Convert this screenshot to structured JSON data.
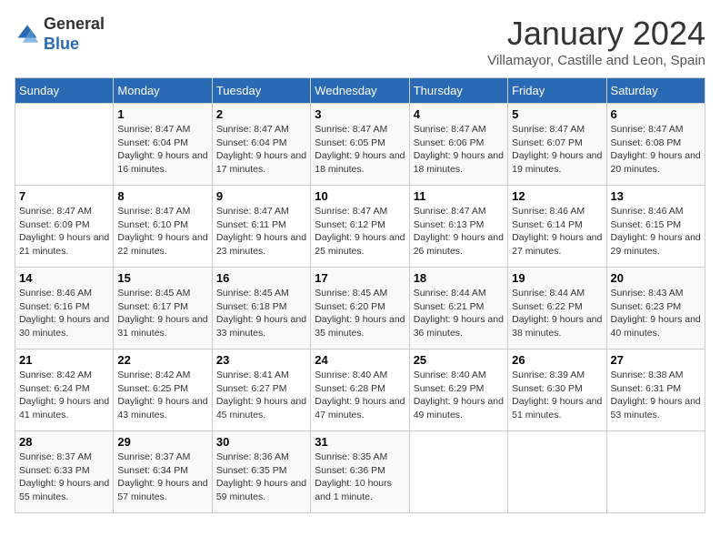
{
  "header": {
    "logo_line1": "General",
    "logo_line2": "Blue",
    "month": "January 2024",
    "location": "Villamayor, Castille and Leon, Spain"
  },
  "days_of_week": [
    "Sunday",
    "Monday",
    "Tuesday",
    "Wednesday",
    "Thursday",
    "Friday",
    "Saturday"
  ],
  "weeks": [
    [
      {
        "day": "",
        "sunrise": "",
        "sunset": "",
        "daylight": ""
      },
      {
        "day": "1",
        "sunrise": "Sunrise: 8:47 AM",
        "sunset": "Sunset: 6:04 PM",
        "daylight": "Daylight: 9 hours and 16 minutes."
      },
      {
        "day": "2",
        "sunrise": "Sunrise: 8:47 AM",
        "sunset": "Sunset: 6:04 PM",
        "daylight": "Daylight: 9 hours and 17 minutes."
      },
      {
        "day": "3",
        "sunrise": "Sunrise: 8:47 AM",
        "sunset": "Sunset: 6:05 PM",
        "daylight": "Daylight: 9 hours and 18 minutes."
      },
      {
        "day": "4",
        "sunrise": "Sunrise: 8:47 AM",
        "sunset": "Sunset: 6:06 PM",
        "daylight": "Daylight: 9 hours and 18 minutes."
      },
      {
        "day": "5",
        "sunrise": "Sunrise: 8:47 AM",
        "sunset": "Sunset: 6:07 PM",
        "daylight": "Daylight: 9 hours and 19 minutes."
      },
      {
        "day": "6",
        "sunrise": "Sunrise: 8:47 AM",
        "sunset": "Sunset: 6:08 PM",
        "daylight": "Daylight: 9 hours and 20 minutes."
      }
    ],
    [
      {
        "day": "7",
        "sunrise": "Sunrise: 8:47 AM",
        "sunset": "Sunset: 6:09 PM",
        "daylight": "Daylight: 9 hours and 21 minutes."
      },
      {
        "day": "8",
        "sunrise": "Sunrise: 8:47 AM",
        "sunset": "Sunset: 6:10 PM",
        "daylight": "Daylight: 9 hours and 22 minutes."
      },
      {
        "day": "9",
        "sunrise": "Sunrise: 8:47 AM",
        "sunset": "Sunset: 6:11 PM",
        "daylight": "Daylight: 9 hours and 23 minutes."
      },
      {
        "day": "10",
        "sunrise": "Sunrise: 8:47 AM",
        "sunset": "Sunset: 6:12 PM",
        "daylight": "Daylight: 9 hours and 25 minutes."
      },
      {
        "day": "11",
        "sunrise": "Sunrise: 8:47 AM",
        "sunset": "Sunset: 6:13 PM",
        "daylight": "Daylight: 9 hours and 26 minutes."
      },
      {
        "day": "12",
        "sunrise": "Sunrise: 8:46 AM",
        "sunset": "Sunset: 6:14 PM",
        "daylight": "Daylight: 9 hours and 27 minutes."
      },
      {
        "day": "13",
        "sunrise": "Sunrise: 8:46 AM",
        "sunset": "Sunset: 6:15 PM",
        "daylight": "Daylight: 9 hours and 29 minutes."
      }
    ],
    [
      {
        "day": "14",
        "sunrise": "Sunrise: 8:46 AM",
        "sunset": "Sunset: 6:16 PM",
        "daylight": "Daylight: 9 hours and 30 minutes."
      },
      {
        "day": "15",
        "sunrise": "Sunrise: 8:45 AM",
        "sunset": "Sunset: 6:17 PM",
        "daylight": "Daylight: 9 hours and 31 minutes."
      },
      {
        "day": "16",
        "sunrise": "Sunrise: 8:45 AM",
        "sunset": "Sunset: 6:18 PM",
        "daylight": "Daylight: 9 hours and 33 minutes."
      },
      {
        "day": "17",
        "sunrise": "Sunrise: 8:45 AM",
        "sunset": "Sunset: 6:20 PM",
        "daylight": "Daylight: 9 hours and 35 minutes."
      },
      {
        "day": "18",
        "sunrise": "Sunrise: 8:44 AM",
        "sunset": "Sunset: 6:21 PM",
        "daylight": "Daylight: 9 hours and 36 minutes."
      },
      {
        "day": "19",
        "sunrise": "Sunrise: 8:44 AM",
        "sunset": "Sunset: 6:22 PM",
        "daylight": "Daylight: 9 hours and 38 minutes."
      },
      {
        "day": "20",
        "sunrise": "Sunrise: 8:43 AM",
        "sunset": "Sunset: 6:23 PM",
        "daylight": "Daylight: 9 hours and 40 minutes."
      }
    ],
    [
      {
        "day": "21",
        "sunrise": "Sunrise: 8:42 AM",
        "sunset": "Sunset: 6:24 PM",
        "daylight": "Daylight: 9 hours and 41 minutes."
      },
      {
        "day": "22",
        "sunrise": "Sunrise: 8:42 AM",
        "sunset": "Sunset: 6:25 PM",
        "daylight": "Daylight: 9 hours and 43 minutes."
      },
      {
        "day": "23",
        "sunrise": "Sunrise: 8:41 AM",
        "sunset": "Sunset: 6:27 PM",
        "daylight": "Daylight: 9 hours and 45 minutes."
      },
      {
        "day": "24",
        "sunrise": "Sunrise: 8:40 AM",
        "sunset": "Sunset: 6:28 PM",
        "daylight": "Daylight: 9 hours and 47 minutes."
      },
      {
        "day": "25",
        "sunrise": "Sunrise: 8:40 AM",
        "sunset": "Sunset: 6:29 PM",
        "daylight": "Daylight: 9 hours and 49 minutes."
      },
      {
        "day": "26",
        "sunrise": "Sunrise: 8:39 AM",
        "sunset": "Sunset: 6:30 PM",
        "daylight": "Daylight: 9 hours and 51 minutes."
      },
      {
        "day": "27",
        "sunrise": "Sunrise: 8:38 AM",
        "sunset": "Sunset: 6:31 PM",
        "daylight": "Daylight: 9 hours and 53 minutes."
      }
    ],
    [
      {
        "day": "28",
        "sunrise": "Sunrise: 8:37 AM",
        "sunset": "Sunset: 6:33 PM",
        "daylight": "Daylight: 9 hours and 55 minutes."
      },
      {
        "day": "29",
        "sunrise": "Sunrise: 8:37 AM",
        "sunset": "Sunset: 6:34 PM",
        "daylight": "Daylight: 9 hours and 57 minutes."
      },
      {
        "day": "30",
        "sunrise": "Sunrise: 8:36 AM",
        "sunset": "Sunset: 6:35 PM",
        "daylight": "Daylight: 9 hours and 59 minutes."
      },
      {
        "day": "31",
        "sunrise": "Sunrise: 8:35 AM",
        "sunset": "Sunset: 6:36 PM",
        "daylight": "Daylight: 10 hours and 1 minute."
      },
      {
        "day": "",
        "sunrise": "",
        "sunset": "",
        "daylight": ""
      },
      {
        "day": "",
        "sunrise": "",
        "sunset": "",
        "daylight": ""
      },
      {
        "day": "",
        "sunrise": "",
        "sunset": "",
        "daylight": ""
      }
    ]
  ]
}
